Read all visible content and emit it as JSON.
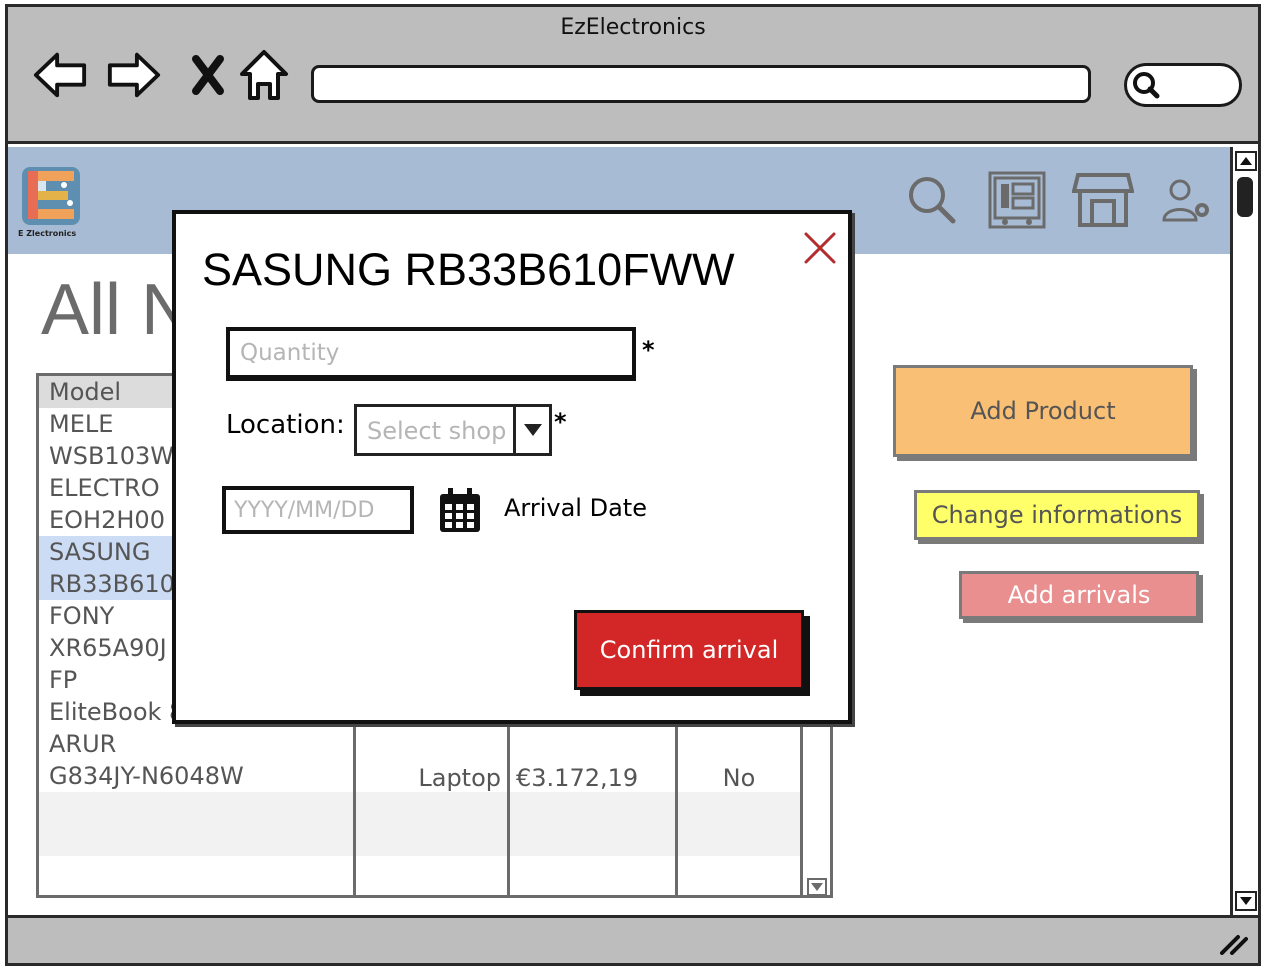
{
  "window": {
    "title": "EzElectronics"
  },
  "browser": {
    "back_icon": "arrow-left-icon",
    "forward_icon": "arrow-right-icon",
    "stop_icon": "close-icon",
    "home_icon": "home-icon",
    "url": "",
    "search_icon": "search-icon"
  },
  "app": {
    "logo_text": "E Zlectronics",
    "header_icons": [
      "search-icon",
      "inventory-icon",
      "store-icon",
      "user-settings-icon"
    ],
    "page_title": "All N",
    "table": {
      "header": "Model",
      "rows": [
        {
          "model_line1": "MELE",
          "model_line2": "WSB103W",
          "category": "",
          "price": "",
          "sold": "",
          "highlighted": false
        },
        {
          "model_line1": "ELECTRO",
          "model_line2": "EOH2H00",
          "category": "",
          "price": "",
          "sold": "",
          "highlighted": false
        },
        {
          "model_line1": "SASUNG",
          "model_line2": "RB33B610",
          "category": "",
          "price": "",
          "sold": "",
          "highlighted": true
        },
        {
          "model_line1": "FONY",
          "model_line2": "XR65A90J",
          "category": "",
          "price": "",
          "sold": "",
          "highlighted": false
        },
        {
          "model_line1": "FP",
          "model_line2": "EliteBook 8",
          "category": "",
          "price": "",
          "sold": "",
          "highlighted": false
        },
        {
          "model_line1": "ARUR",
          "model_line2": "G834JY-N6048W",
          "category": "Laptop",
          "price": "€3.172,19",
          "sold": "No",
          "highlighted": false
        }
      ]
    },
    "buttons": {
      "add_product": "Add Product",
      "change_informations": "Change informations",
      "add_arrivals": "Add arrivals"
    }
  },
  "modal": {
    "title": "SASUNG RB33B610FWW",
    "quantity_placeholder": "Quantity",
    "required_mark": "*",
    "location_label": "Location:",
    "location_select": "Select shop",
    "date_placeholder": "YYYY/MM/DD",
    "arrival_date_label": "Arrival Date",
    "confirm_label": "Confirm arrival"
  },
  "colors": {
    "header_bg": "#a8bbd4",
    "add_product": "#f9bf74",
    "change_info": "#ffff6a",
    "add_arrivals": "#ea8f8f",
    "confirm": "#d32727",
    "row_highlight": "#cddcf5"
  }
}
